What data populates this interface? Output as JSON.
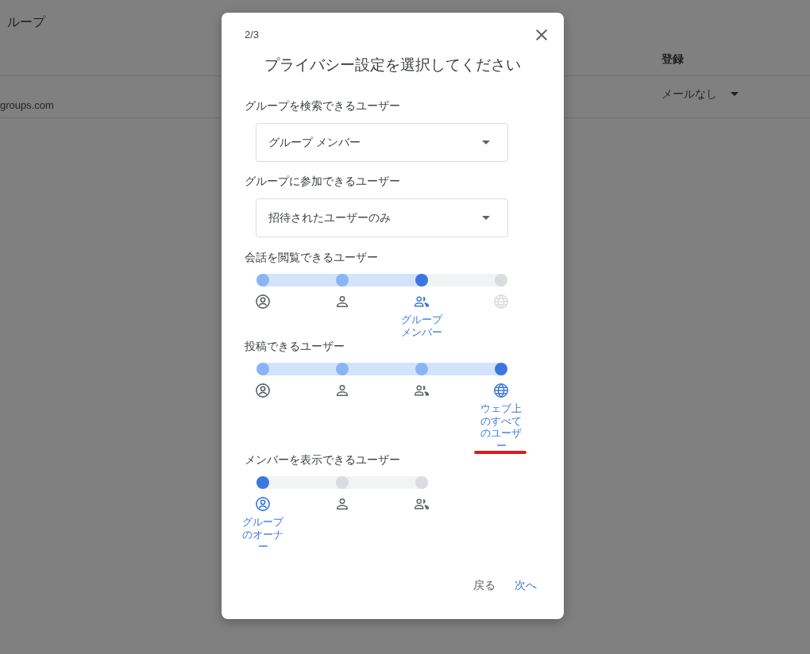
{
  "page": {
    "title": "ループ",
    "table": {
      "columns": [
        {
          "label": "登録"
        }
      ],
      "rows": [
        {
          "column_1": "groups.com",
          "subscription": "メールなし"
        }
      ]
    }
  },
  "dialog": {
    "step": "2/3",
    "title": "プライバシー設定を選択してください",
    "selects": [
      {
        "label": "グループを検索できるユーザー",
        "value": "グループ メンバー"
      },
      {
        "label": "グループに参加できるユーザー",
        "value": "招待されたユーザーのみ"
      }
    ],
    "sliders": [
      {
        "label": "会話を閲覧できるユーザー",
        "underlined": false,
        "options": [
          {
            "kind": "account",
            "selected": false,
            "disabled": false
          },
          {
            "kind": "person",
            "selected": false,
            "disabled": false
          },
          {
            "kind": "people",
            "selected": true,
            "disabled": false,
            "label": "グループメンバー"
          },
          {
            "kind": "globe",
            "selected": false,
            "disabled": true
          }
        ]
      },
      {
        "label": "投稿できるユーザー",
        "underlined": true,
        "options": [
          {
            "kind": "account",
            "selected": false,
            "disabled": false
          },
          {
            "kind": "person",
            "selected": false,
            "disabled": false
          },
          {
            "kind": "people",
            "selected": false,
            "disabled": false
          },
          {
            "kind": "globe",
            "selected": true,
            "disabled": false,
            "label": "ウェブ上のすべてのユーザー"
          }
        ]
      },
      {
        "label": "メンバーを表示できるユーザー",
        "underlined": false,
        "options": [
          {
            "kind": "account",
            "selected": true,
            "disabled": false,
            "label": "グループのオーナー"
          },
          {
            "kind": "person",
            "selected": false,
            "disabled": false
          },
          {
            "kind": "people",
            "selected": false,
            "disabled": false
          }
        ]
      }
    ],
    "buttons": [
      {
        "label": "戻る",
        "kind": "secondary"
      },
      {
        "label": "次へ",
        "kind": "primary"
      }
    ]
  }
}
